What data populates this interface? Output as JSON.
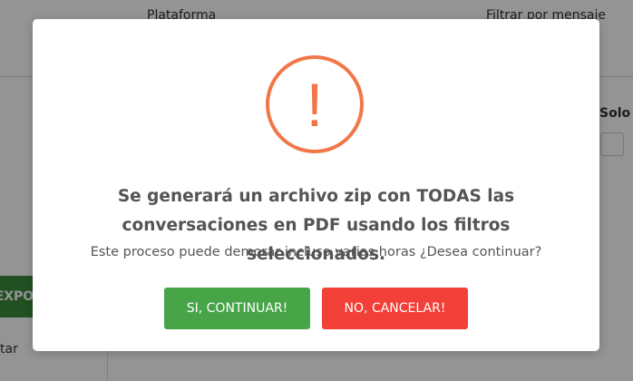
{
  "background": {
    "header_labels": [
      "Plataforma",
      "Filtrar por mensaje"
    ],
    "side_label": "Solo",
    "export_button": "EXPOR",
    "side_text": "tar"
  },
  "dialog": {
    "icon": "exclamation-circle-icon",
    "icon_color": "#f27748",
    "icon_glyph": "!",
    "title": "Se generará un archivo zip con TODAS las conversaciones en PDF usando los filtros seleccionados.",
    "text": "Este proceso puede demorar incluso varias horas ¿Desea continuar?",
    "confirm_label": "SI, CONTINUAR!",
    "cancel_label": "NO, CANCELAR!",
    "confirm_color": "#47a548",
    "cancel_color": "#f23f37"
  }
}
